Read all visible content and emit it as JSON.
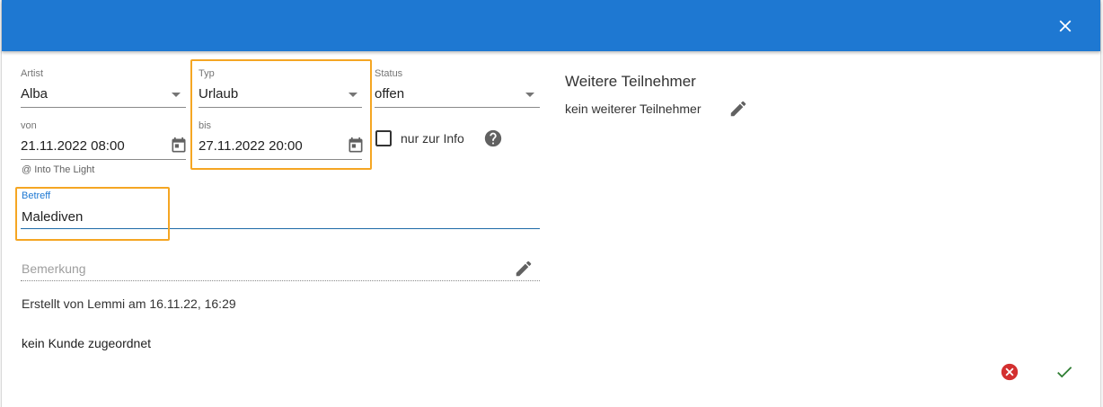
{
  "dialog": {
    "close_icon": "close-icon"
  },
  "form": {
    "artist": {
      "label": "Artist",
      "value": "Alba"
    },
    "typ": {
      "label": "Typ",
      "value": "Urlaub"
    },
    "status": {
      "label": "Status",
      "value": "offen"
    },
    "von": {
      "label": "von",
      "value": "21.11.2022 08:00",
      "hint": "@ Into The Light"
    },
    "bis": {
      "label": "bis",
      "value": "27.11.2022 20:00"
    },
    "info_checkbox": {
      "label": "nur zur Info",
      "checked": false
    },
    "betreff": {
      "label": "Betreff",
      "value": "Malediven"
    },
    "bemerkung": {
      "placeholder": "Bemerkung",
      "value": ""
    },
    "created_text": "Erstellt von Lemmi am 16.11.22, 16:29",
    "customer_text": "kein Kunde zugeordnet"
  },
  "participants": {
    "title": "Weitere Teilnehmer",
    "empty_text": "kein weiterer Teilnehmer"
  },
  "actions": {
    "cancel_icon": "cancel-icon",
    "confirm_icon": "check-icon"
  },
  "colors": {
    "header": "#1e78d2",
    "highlight": "#f5a623",
    "focus": "#1e78d2",
    "cancel": "#d32f2f",
    "confirm": "#2e7d32"
  }
}
